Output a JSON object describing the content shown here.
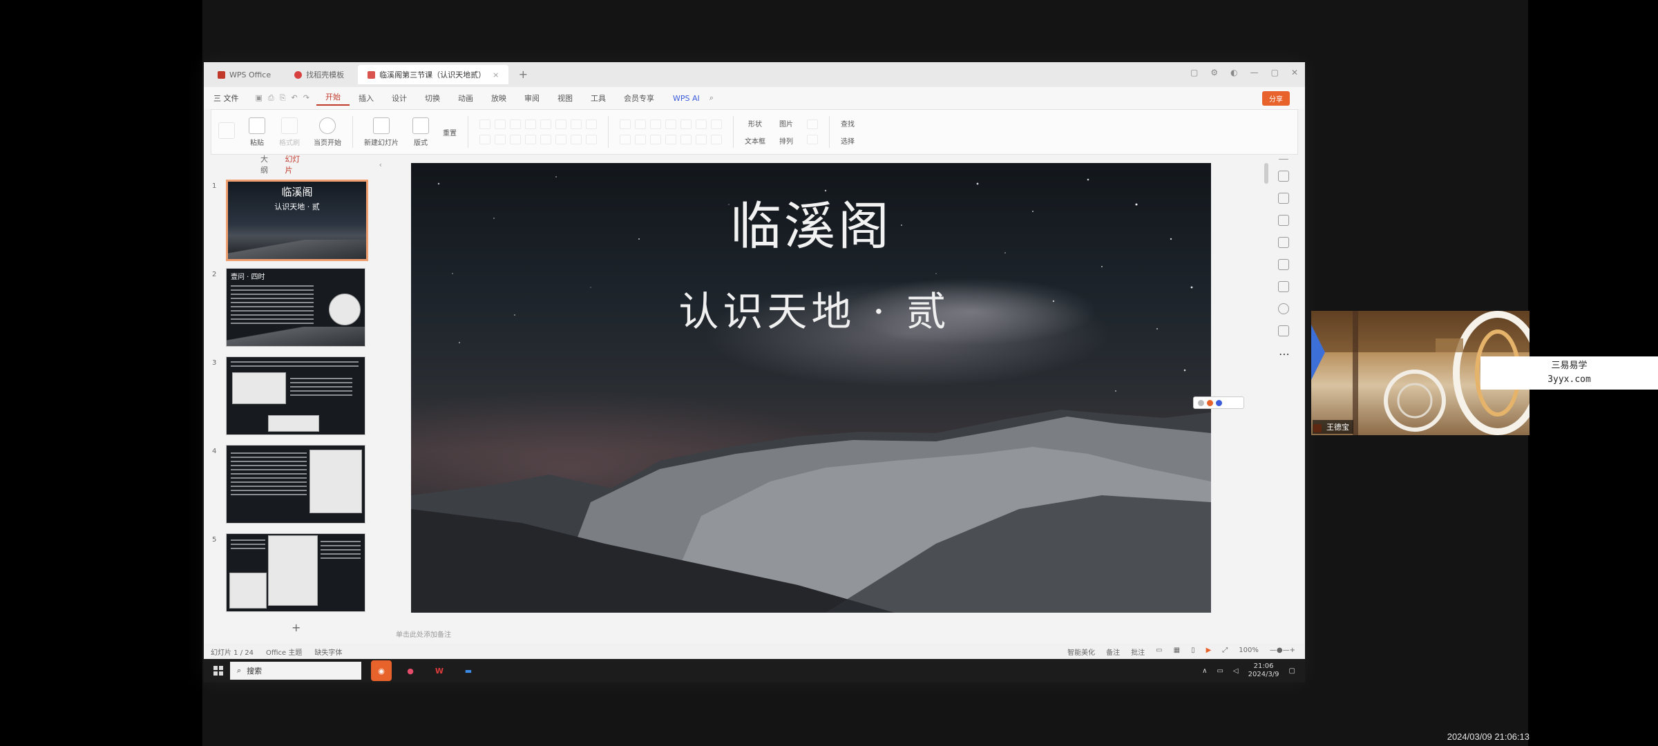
{
  "tabs": [
    {
      "label": "WPS Office",
      "color": "#c0392b"
    },
    {
      "label": "找稻壳模板",
      "color": "#d84040"
    },
    {
      "label": "临溪阁第三节课（认识天地贰）",
      "color": "#d9534f"
    }
  ],
  "menu": {
    "file": "三 文件",
    "items": [
      "开始",
      "插入",
      "设计",
      "切换",
      "动画",
      "放映",
      "审阅",
      "视图",
      "工具",
      "会员专享"
    ],
    "active": "开始",
    "ai": "WPS AI",
    "share": "分享"
  },
  "ribbon": {
    "paste": "粘贴",
    "format": "格式刷",
    "play": "当页开始",
    "new_slide": "新建幻灯片",
    "layout": "版式",
    "reset": "重置",
    "shape": "形状",
    "arrange": "排列",
    "find": "查找",
    "textbox": "文本框",
    "select": "选择",
    "image": "图片"
  },
  "pane": {
    "outline": "大纲",
    "slides": "幻灯片",
    "add": "+"
  },
  "thumbs": [
    {
      "num": "1",
      "title": "临溪阁",
      "sub": "认识天地 · 贰"
    },
    {
      "num": "2",
      "heading": "壹问 · 四时"
    },
    {
      "num": "3"
    },
    {
      "num": "4"
    },
    {
      "num": "5"
    }
  ],
  "slide": {
    "title": "临溪阁",
    "subtitle": "认识天地 · 贰"
  },
  "notes_placeholder": "单击此处添加备注",
  "status": {
    "slide_count": "幻灯片 1 / 24",
    "theme": "Office 主题",
    "font": "缺失字体",
    "beautify": "智能美化",
    "notes": "备注",
    "comment": "批注",
    "zoom": "100%"
  },
  "taskbar": {
    "search": "搜索",
    "time": "21:06",
    "date": "2024/3/9"
  },
  "webcam": {
    "name": "王德宝"
  },
  "watermark": {
    "line1": "三易易学",
    "line2": "3yyx.com"
  },
  "recording_timestamp": "2024/03/09 21:06:13"
}
